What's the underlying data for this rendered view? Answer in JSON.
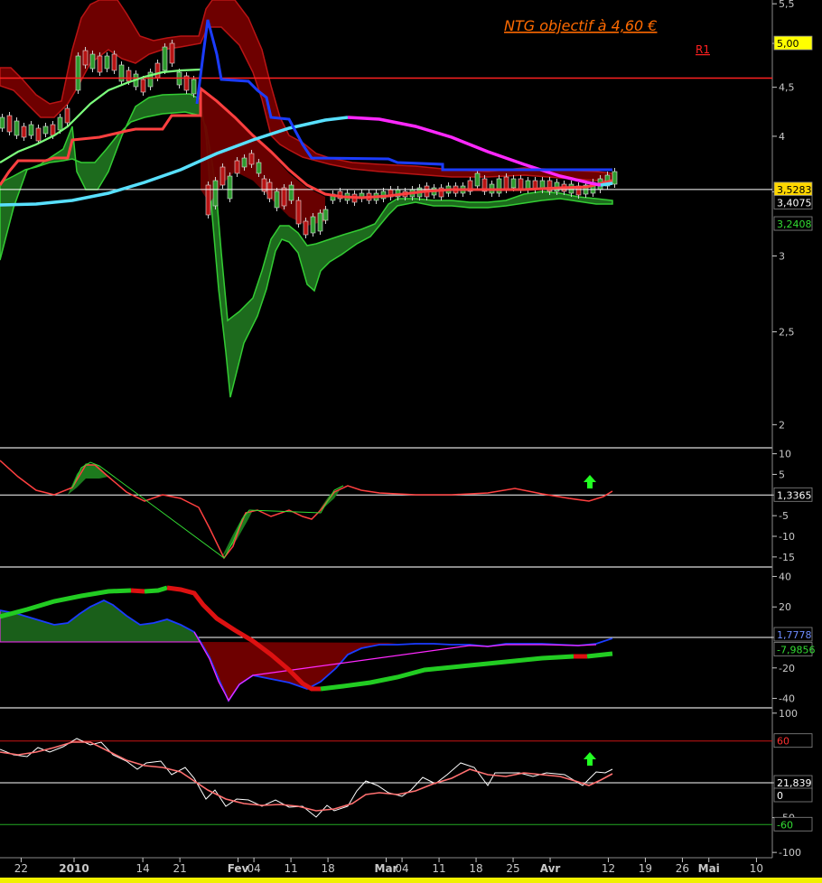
{
  "chart_data": [
    {
      "type": "line",
      "panel": "price",
      "annotation": "NTG objectif à 4,60 €",
      "target_label": "R1",
      "target_level": 4.6,
      "last_price_level": 3.52,
      "yticks": [
        "5,5",
        "5",
        "4,5",
        "4",
        "3,5",
        "3",
        "2,5",
        "2"
      ],
      "ytick_values": [
        5.5,
        5,
        4.5,
        4,
        3.5,
        3,
        2.5,
        2
      ],
      "y_range": [
        1.9,
        5.55
      ],
      "badges": [
        {
          "label": "5,00",
          "value": 5.0,
          "bg": "#ffff00",
          "fg": "#000000"
        },
        {
          "label": "3,5283",
          "value": 3.52,
          "bg": "#ffd700",
          "fg": "#000000"
        },
        {
          "label": "3,4075",
          "value": 3.41,
          "bg": "#000000",
          "fg": "#ffffff"
        },
        {
          "label": "3,2408",
          "value": 3.24,
          "bg": "#000000",
          "fg": "#33dd33"
        }
      ]
    },
    {
      "type": "line",
      "panel": "oscillator",
      "yticks": [
        "10",
        "5",
        "0",
        "-5",
        "-10",
        "-15"
      ],
      "ytick_values": [
        10,
        5,
        0,
        -5,
        -10,
        -15
      ],
      "y_range": [
        -17,
        11
      ],
      "badges": [
        {
          "label": "1,3365",
          "value": 0,
          "bg": "#000000",
          "fg": "#ffffff"
        }
      ],
      "signal": "up-arrow"
    },
    {
      "type": "area",
      "panel": "trend",
      "yticks": [
        "40",
        "20",
        "0",
        "-20",
        "-40"
      ],
      "ytick_values": [
        40,
        20,
        0,
        -20,
        -40
      ],
      "y_range": [
        -45,
        45
      ],
      "badges": [
        {
          "label": "1,7778",
          "value": 1.78,
          "bg": "#000000",
          "fg": "#6e8cff"
        },
        {
          "label": "-7,9856",
          "value": -7.99,
          "bg": "#000000",
          "fg": "#33dd33"
        }
      ]
    },
    {
      "type": "line",
      "panel": "rsi",
      "yticks": [
        "100",
        "0",
        "-50",
        "-100"
      ],
      "ytick_values": [
        100,
        0,
        -50,
        -100
      ],
      "y_range": [
        -105,
        105
      ],
      "badges": [
        {
          "label": "60",
          "value": 60,
          "bg": "#000000",
          "fg": "#ff3030"
        },
        {
          "label": "21,839",
          "value": 0,
          "bg": "#000000",
          "fg": "#ffffff"
        },
        {
          "label": "0",
          "value": 0,
          "bg": "#000000",
          "fg": "#ffffff"
        },
        {
          "label": "-60",
          "value": -60,
          "bg": "#000000",
          "fg": "#33dd33"
        }
      ],
      "signal": "up-arrow"
    }
  ],
  "x_axis": {
    "ticks": [
      {
        "label": "22",
        "day": -10
      },
      {
        "label": "2010",
        "day": 0,
        "bold": true
      },
      {
        "label": "14",
        "day": 13
      },
      {
        "label": "21",
        "day": 20
      },
      {
        "label": "Fev",
        "day": 31,
        "bold": true
      },
      {
        "label": "04",
        "day": 34
      },
      {
        "label": "11",
        "day": 41
      },
      {
        "label": "18",
        "day": 48
      },
      {
        "label": "Mar",
        "day": 59,
        "bold": true
      },
      {
        "label": "04",
        "day": 62
      },
      {
        "label": "11",
        "day": 69
      },
      {
        "label": "18",
        "day": 76
      },
      {
        "label": "25",
        "day": 83
      },
      {
        "label": "Avr",
        "day": 90,
        "bold": true
      },
      {
        "label": "12",
        "day": 101
      },
      {
        "label": "19",
        "day": 108
      },
      {
        "label": "26",
        "day": 115
      },
      {
        "label": "Mai",
        "day": 120,
        "bold": true
      },
      {
        "label": "10",
        "day": 129
      }
    ]
  },
  "colors": {
    "background": "#000000",
    "bull": "#2e8b2e",
    "bear": "#b81414",
    "target": "#ff2020",
    "ma_cyan": "#58e0ff",
    "ma_magenta": "#ff28ff",
    "stop_blue": "#1b3cff",
    "envelope_red": "#ff4040",
    "grid": "#ffffff"
  }
}
